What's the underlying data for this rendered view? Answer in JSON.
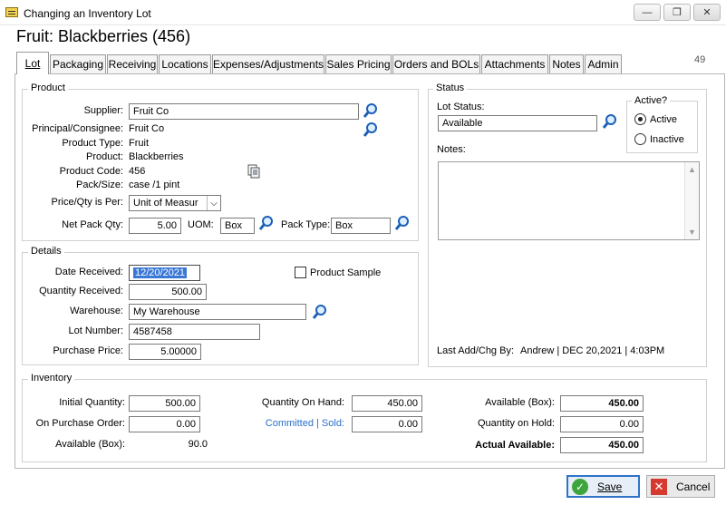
{
  "window": {
    "title": "Changing an Inventory Lot",
    "minimize": "—",
    "maximize": "❐",
    "close": "✕"
  },
  "heading": "Fruit: Blackberries (456)",
  "record_number": "49",
  "tabs": [
    "Lot",
    "Packaging",
    "Receiving",
    "Locations",
    "Expenses/Adjustments",
    "Sales Pricing",
    "Orders and BOLs",
    "Attachments",
    "Notes",
    "Admin"
  ],
  "product": {
    "group_label": "Product",
    "supplier_label": "Supplier:",
    "supplier": "Fruit Co",
    "principal_label": "Principal/Consignee:",
    "principal": "Fruit Co",
    "product_type_label": "Product Type:",
    "product_type": "Fruit",
    "product_label": "Product:",
    "product": "Blackberries",
    "product_code_label": "Product Code:",
    "product_code": "456",
    "pack_size_label": "Pack/Size:",
    "pack_size": "case /1 pint",
    "price_qty_label": "Price/Qty is Per:",
    "price_qty": "Unit of Measur",
    "net_pack_qty_label": "Net Pack Qty:",
    "net_pack_qty": "5.00",
    "uom_label": "UOM:",
    "uom": "Box",
    "pack_type_label": "Pack Type:",
    "pack_type": "Box"
  },
  "details": {
    "group_label": "Details",
    "date_received_label": "Date Received:",
    "date_received": "12/20/2021",
    "product_sample_label": "Product Sample",
    "qty_received_label": "Quantity Received:",
    "qty_received": "500.00",
    "warehouse_label": "Warehouse:",
    "warehouse": "My Warehouse",
    "lot_number_label": "Lot Number:",
    "lot_number": "4587458",
    "purchase_price_label": "Purchase Price:",
    "purchase_price": "5.00000"
  },
  "status": {
    "group_label": "Status",
    "lot_status_label": "Lot Status:",
    "lot_status": "Available",
    "active_label": "Active?",
    "active_option": "Active",
    "inactive_option": "Inactive",
    "notes_label": "Notes:",
    "notes": "",
    "last_change_label": "Last Add/Chg By:",
    "last_change": "Andrew | DEC 20,2021 |  4:03PM"
  },
  "inventory": {
    "group_label": "Inventory",
    "initial_qty_label": "Initial Quantity:",
    "initial_qty": "500.00",
    "on_po_label": "On Purchase Order:",
    "on_po": "0.00",
    "available_box_left_label": "Available (Box):",
    "available_box_left": "90.0",
    "qty_on_hand_label": "Quantity On Hand:",
    "qty_on_hand": "450.00",
    "committed_label": "Committed | Sold:",
    "committed": "0.00",
    "available_box_label": "Available (Box):",
    "available_box": "450.00",
    "qty_on_hold_label": "Quantity on Hold:",
    "qty_on_hold": "0.00",
    "actual_available_label": "Actual Available:",
    "actual_available": "450.00"
  },
  "buttons": {
    "save": "Save",
    "cancel": "Cancel"
  },
  "colors": {
    "accent": "#2f73c8",
    "link": "#2a6fc9",
    "save_green": "#3da53b",
    "cancel_red": "#d63a2f",
    "selection": "#3a78d6"
  }
}
